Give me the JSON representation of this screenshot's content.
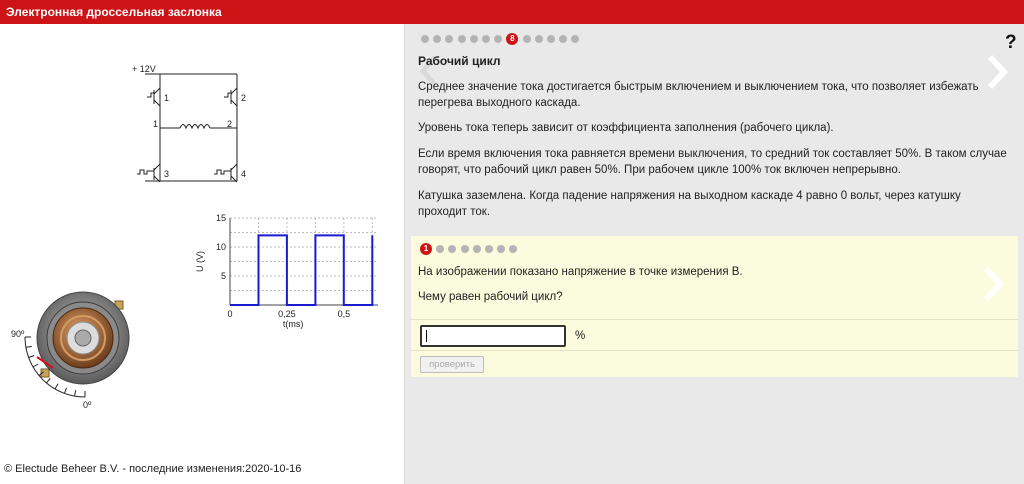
{
  "app": {
    "title": "Электронная дроссельная заслонка"
  },
  "footer": {
    "text": "© Electude Beheer B.V. - последние изменения:2020-10-16"
  },
  "circuit": {
    "supply_label": "+ 12V",
    "labels": [
      "1",
      "2",
      "1",
      "2",
      "3",
      "4"
    ]
  },
  "gauge": {
    "max_label": "90º",
    "min_label": "0º"
  },
  "chart_data": {
    "type": "line",
    "xlabel": "t(ms)",
    "ylabel": "U (V)",
    "xlim": [
      0,
      0.65
    ],
    "ylim": [
      0,
      15
    ],
    "x_ticks": [
      "0",
      "0,25",
      "0,5"
    ],
    "y_ticks": [
      "15",
      "10",
      "5"
    ],
    "grid": true,
    "series": [
      {
        "color": "#1a1ad0",
        "x": [
          0,
          0.125,
          0.125,
          0.25,
          0.25,
          0.375,
          0.375,
          0.5,
          0.5,
          0.625,
          0.625
        ],
        "y": [
          0,
          0,
          12,
          12,
          0,
          0,
          12,
          12,
          0,
          0,
          12
        ]
      }
    ]
  },
  "lesson": {
    "step_count": 13,
    "current_step": 8,
    "current_label": "8",
    "help_label": "?",
    "title": "Рабочий цикл",
    "paragraphs": [
      "Среднее значение тока достигается быстрым включением и выключением тока, что позволяет избежать перегрева выходного каскада.",
      "Уровень тока теперь зависит от коэффициента заполнения (рабочего цикла).",
      "Если время включения тока равняется времени выключения, то средний ток составляет 50%. В таком случае говорят, что рабочий цикл равен 50%. При рабочем цикле 100% ток включен непрерывно.",
      "Катушка заземлена. Когда падение напряжения на выходном каскаде 4 равно 0 вольт, через катушку проходит ток."
    ]
  },
  "quiz": {
    "step_count": 8,
    "current_step": 1,
    "current_label": "1",
    "question": "На изображении показано напряжение в точке измерения B.",
    "prompt": "Чему равен рабочий цикл?",
    "answer_value": "",
    "unit": "%",
    "check_label": "проверить"
  },
  "colors": {
    "brand": "#cc1316",
    "quiz_bg": "#fbfbdd",
    "panel_bg": "#e9e9e9",
    "signal": "#1a1ad0"
  }
}
